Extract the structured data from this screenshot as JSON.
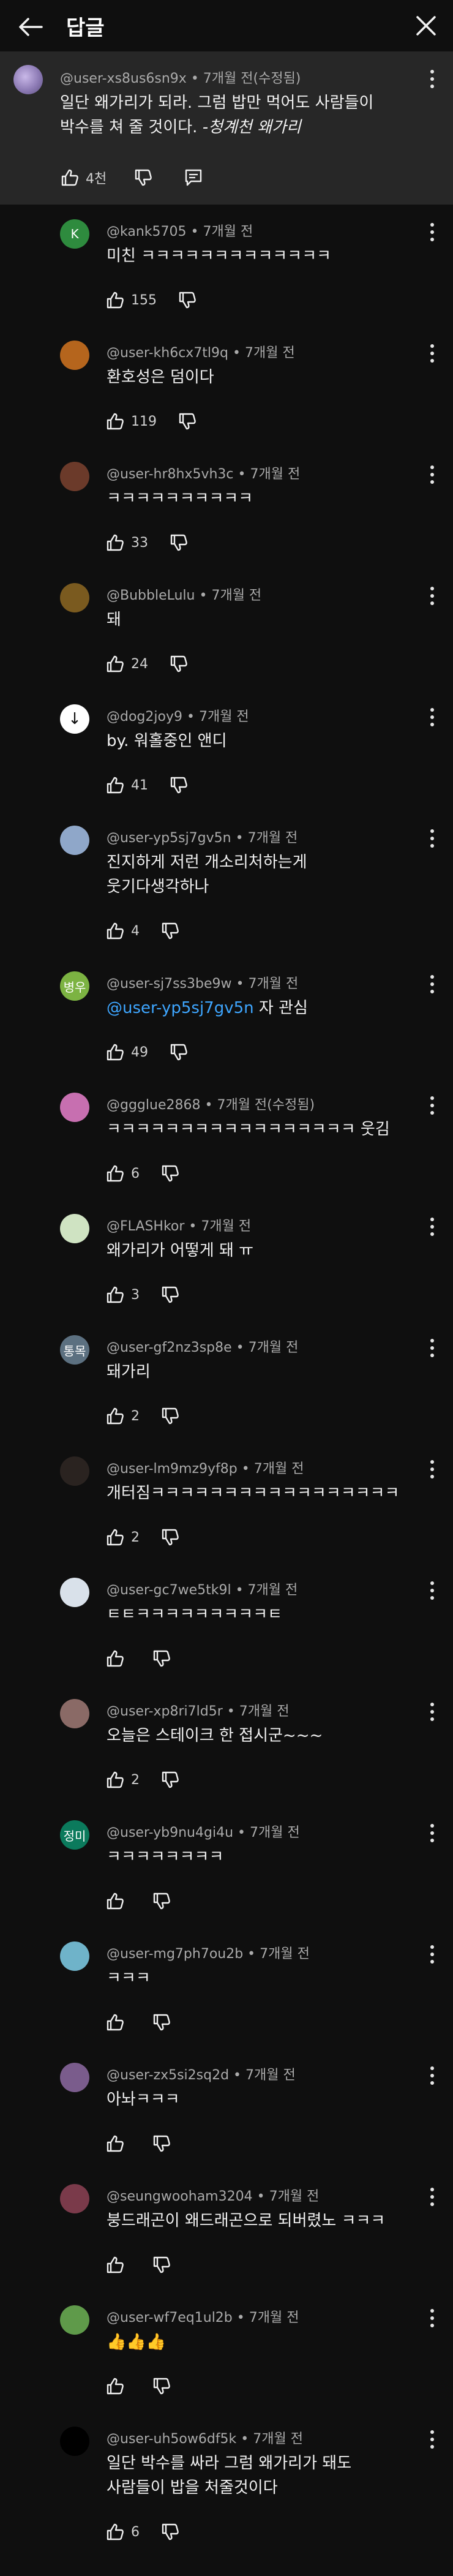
{
  "header": {
    "title": "답글",
    "back_icon": "arrow-left-icon",
    "close_icon": "close-icon"
  },
  "parent": {
    "author": "@user-xs8us6sn9x",
    "time": "7개월 전(수정됨)",
    "text_line1": "일단 왜가리가 되라. 그럼 밥만 먹어도 사람들이",
    "text_line2_prefix": "박수를 쳐 줄 것이다. ",
    "text_line2_italic": "-청계천 왜가리",
    "likes": "4천"
  },
  "replies": [
    {
      "author": "@kank5705",
      "time": "7개월 전",
      "lines": [
        "미친 ㅋㅋㅋㅋㅋㅋㅋㅋㅋㅋㅋㅋㅋ"
      ],
      "likes": "155",
      "avatar_text": "K",
      "avatar_color": "#2e8b3e"
    },
    {
      "author": "@user-kh6cx7tl9q",
      "time": "7개월 전",
      "lines": [
        "환호성은 덤이다"
      ],
      "likes": "119",
      "avatar_text": "",
      "avatar_color": "#b5651d"
    },
    {
      "author": "@user-hr8hx5vh3c",
      "time": "7개월 전",
      "lines": [
        "ㅋㅋㅋㅋㅋㅋㅋㅋㅋㅋ"
      ],
      "likes": "33",
      "avatar_text": "",
      "avatar_color": "#6b3a2a"
    },
    {
      "author": "@BubbleLulu",
      "time": "7개월 전",
      "lines": [
        "돼"
      ],
      "likes": "24",
      "avatar_text": "",
      "avatar_color": "#7a5a1f"
    },
    {
      "author": "@dog2joy9",
      "time": "7개월 전",
      "lines": [
        "by. 워홀중인 앤디"
      ],
      "likes": "41",
      "avatar_text": "↓",
      "avatar_color": "#ffffff"
    },
    {
      "author": "@user-yp5sj7gv5n",
      "time": "7개월 전",
      "lines": [
        "진지하게 저런 개소리처하는게",
        "웃기다생각하나"
      ],
      "likes": "4",
      "avatar_text": "",
      "avatar_color": "#8fa7c9",
      "tall": true
    },
    {
      "author": "@user-sj7ss3be9w",
      "time": "7개월 전",
      "mention": "@user-yp5sj7gv5n",
      "lines": [
        " 자 관심"
      ],
      "likes": "49",
      "avatar_text": "병우",
      "avatar_color": "#7cb342"
    },
    {
      "author": "@ggglue2868",
      "time": "7개월 전(수정됨)",
      "lines": [
        "ㅋㅋㅋㅋㅋㅋㅋㅋㅋㅋㅋㅋㅋㅋㅋㅋㅋ 웃김"
      ],
      "likes": "6",
      "avatar_text": "",
      "avatar_color": "#c76fb0"
    },
    {
      "author": "@FLASHkor",
      "time": "7개월 전",
      "lines": [
        "왜가리가 어떻게 돼 ㅠ"
      ],
      "likes": "3",
      "avatar_text": "",
      "avatar_color": "#cfe3c2"
    },
    {
      "author": "@user-gf2nz3sp8e",
      "time": "7개월 전",
      "lines": [
        "돼가리"
      ],
      "likes": "2",
      "avatar_text": "통목",
      "avatar_color": "#5c7080"
    },
    {
      "author": "@user-lm9mz9yf8p",
      "time": "7개월 전",
      "lines": [
        "개터짐ㅋㅋㅋㅋㅋㅋㅋㅋㅋㅋㅋㅋㅋㅋㅋㅋㅋ"
      ],
      "likes": "2",
      "avatar_text": "",
      "avatar_color": "#2a2320"
    },
    {
      "author": "@user-gc7we5tk9l",
      "time": "7개월 전",
      "lines": [
        "ㅌㅌㅋㅋㅋㅋㅋㅋㅋㅋㅋㅌ"
      ],
      "likes": "",
      "avatar_text": "",
      "avatar_color": "#d9e1ea"
    },
    {
      "author": "@user-xp8ri7ld5r",
      "time": "7개월 전",
      "lines": [
        "오늘은 스테이크 한 접시군~~~"
      ],
      "likes": "2",
      "avatar_text": "",
      "avatar_color": "#8a6a66"
    },
    {
      "author": "@user-yb9nu4gi4u",
      "time": "7개월 전",
      "lines": [
        "ㅋㅋㅋㅋㅋㅋㅋㅋ"
      ],
      "likes": "",
      "avatar_text": "정미",
      "avatar_color": "#0b7a5c"
    },
    {
      "author": "@user-mg7ph7ou2b",
      "time": "7개월 전",
      "lines": [
        "ㅋㅋㅋ"
      ],
      "likes": "",
      "avatar_text": "",
      "avatar_color": "#6fb3c9"
    },
    {
      "author": "@user-zx5si2sq2d",
      "time": "7개월 전",
      "lines": [
        "아놔ㅋㅋㅋ"
      ],
      "likes": "",
      "avatar_text": "",
      "avatar_color": "#7a5c8c"
    },
    {
      "author": "@seungwooham3204",
      "time": "7개월 전",
      "lines": [
        "붕드래곤이 왜드래곤으로 되버렸노 ㅋㅋㅋ"
      ],
      "likes": "",
      "avatar_text": "",
      "avatar_color": "#7a3a4a"
    },
    {
      "author": "@user-wf7eq1ul2b",
      "time": "7개월 전",
      "lines": [
        "👍👍👍"
      ],
      "likes": "",
      "avatar_text": "",
      "avatar_color": "#5f9a4a"
    },
    {
      "author": "@user-uh5ow6df5k",
      "time": "7개월 전",
      "lines": [
        "일단 박수를 싸라 그럼 왜가리가 돼도",
        "사람들이 밥을 처줄것이다"
      ],
      "likes": "6",
      "avatar_text": "",
      "avatar_color": "#000000",
      "tall": true
    }
  ]
}
